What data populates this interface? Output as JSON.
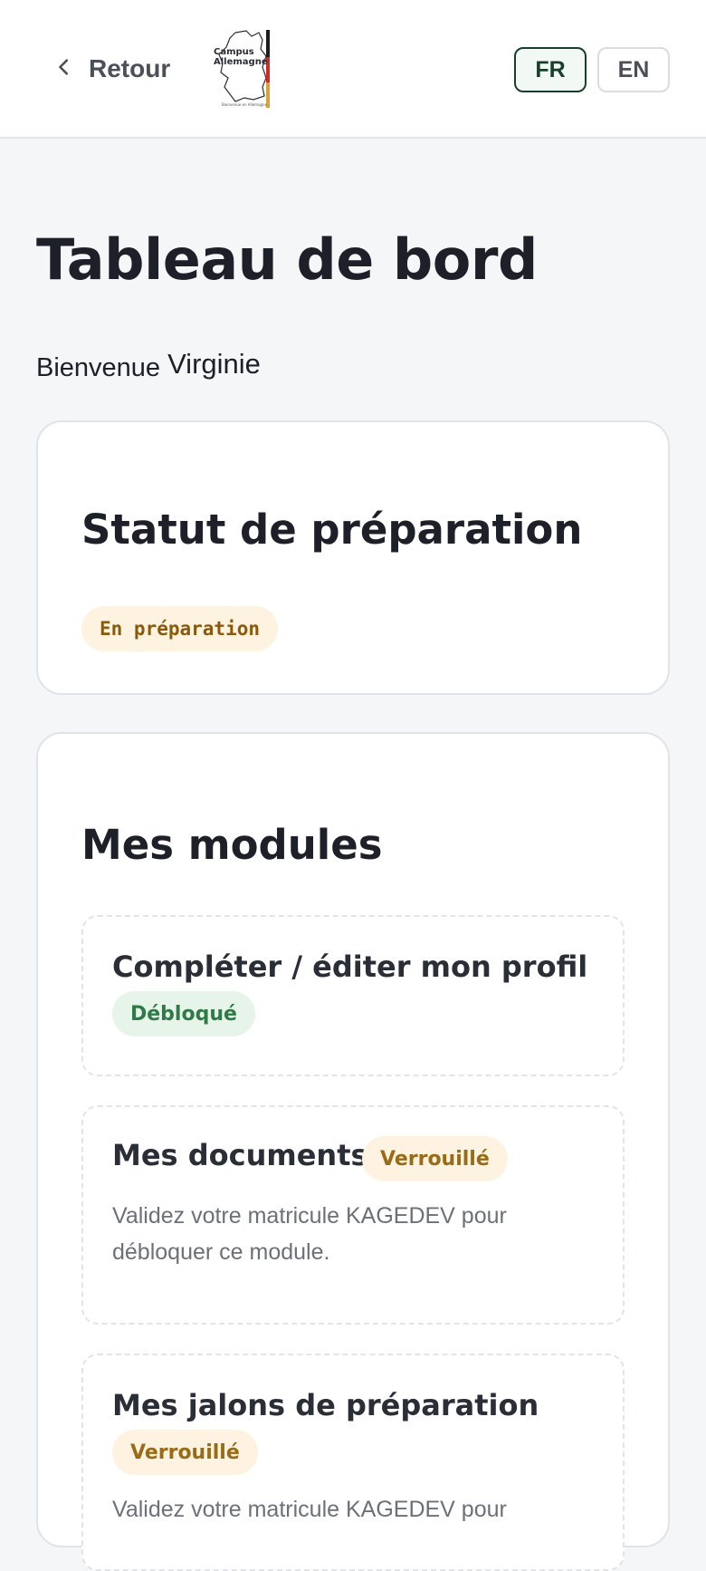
{
  "header": {
    "back_label": "Retour",
    "logo": {
      "line1": "Campus",
      "line2": "Allemagne",
      "tagline": "Bienvenue en Allemagne"
    },
    "languages": [
      {
        "label": "FR",
        "active": true
      },
      {
        "label": "EN",
        "active": false
      }
    ]
  },
  "page": {
    "title": "Tableau de bord",
    "welcome_label": "Bienvenue",
    "user_name": "Virginie"
  },
  "status_card": {
    "title": "Statut de préparation",
    "badge": "En préparation"
  },
  "modules_card": {
    "title": "Mes modules",
    "modules": [
      {
        "title": "Compléter / éditer mon profil",
        "status": "Débloqué",
        "description": ""
      },
      {
        "title": "Mes documents",
        "status": "Verrouillé",
        "description": "Validez votre matricule KAGEDEV pour débloquer ce module."
      },
      {
        "title": "Mes jalons de préparation",
        "status": "Verrouillé",
        "description": "Validez votre matricule KAGEDEV pour"
      }
    ]
  },
  "colors": {
    "accent_dark_green": "#173f2b",
    "unlocked_text": "#2f7a47",
    "unlocked_bg": "#e6f4ea",
    "locked_text": "#9a6b16",
    "locked_bg": "#fdf3e0",
    "page_bg": "#f5f6f8"
  },
  "icons": {
    "back": "chevron-left-icon",
    "logo": "germany-map-logo"
  }
}
